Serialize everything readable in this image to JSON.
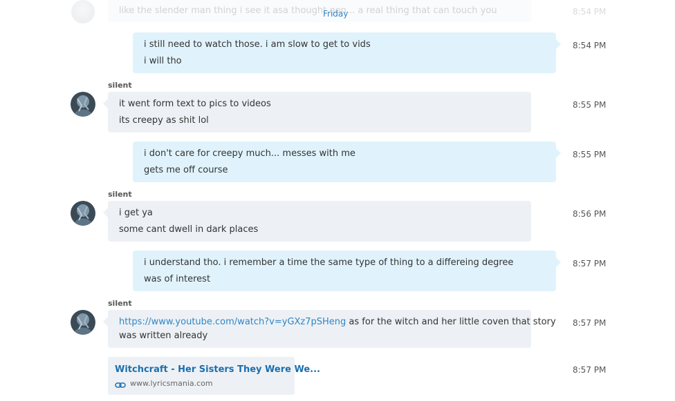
{
  "day_divider": "Friday",
  "faded_message": {
    "text": "like the slender man thing i see it asa thought gen... a real thing that can touch you",
    "time": "8:54 PM"
  },
  "messages": [
    {
      "side": "out",
      "lines": [
        "i still need to watch those.  i am slow to get to vids",
        "i will tho"
      ],
      "time": "8:54 PM"
    },
    {
      "side": "in",
      "sender": "silent",
      "lines": [
        "it went form text to pics  to videos",
        "its creepy as shit lol"
      ],
      "time": "8:55 PM"
    },
    {
      "side": "out",
      "lines": [
        "i don't care for creepy much...  messes with me",
        "gets me off course"
      ],
      "time": "8:55 PM"
    },
    {
      "side": "in",
      "sender": "silent",
      "lines": [
        "i get ya",
        "some cant dwell in dark places"
      ],
      "time": "8:56 PM"
    },
    {
      "side": "out",
      "lines": [
        "i understand tho.  i remember a time the same type of thing to a differeing degree",
        "was of interest"
      ],
      "time": "8:57 PM"
    },
    {
      "side": "in",
      "sender": "silent",
      "link": "https://www.youtube.com/watch?v=yGXz7pSHeng",
      "line1_rest": " as for the witch and her little coven that story",
      "line2": "was written already",
      "time": "8:57 PM"
    }
  ],
  "link_card": {
    "title": "Witchcraft - Her Sisters They Were We...",
    "domain": "www.lyricsmania.com",
    "icon": "link-icon",
    "time": "8:57 PM"
  },
  "colors": {
    "incoming_bubble": "#edf1f5",
    "outgoing_bubble": "#e0f3fc",
    "link": "#2f86c6"
  }
}
